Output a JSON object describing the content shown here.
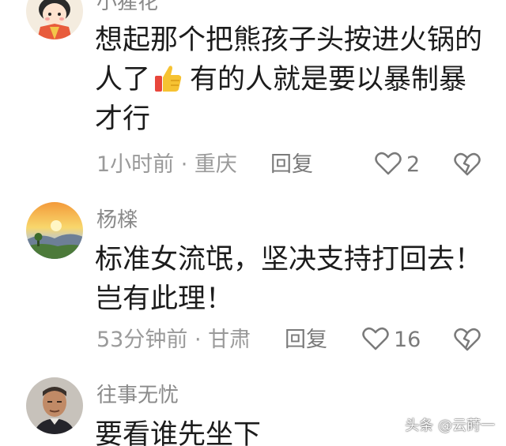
{
  "comments": [
    {
      "username": "小猩花",
      "lines": [
        "想起那个把熊孩子头按进火锅的",
        "人了",
        "有的人就是要以暴制暴",
        "才行"
      ],
      "emoji": "thumbs-up",
      "time_location": "1小时前 · 重庆",
      "reply_label": "回复",
      "like_count": "2"
    },
    {
      "username": "杨檪",
      "lines": [
        "标准女流氓，坚决支持打回去！",
        "岂有此理！"
      ],
      "time_location": "53分钟前 · 甘肃",
      "reply_label": "回复",
      "like_count": "16"
    },
    {
      "username": "往事无忧",
      "lines": [
        "要看谁先坐下"
      ]
    }
  ],
  "watermark": "头条 @云莳一",
  "colors": {
    "background": "#ffffff",
    "text": "#1c1c1c",
    "meta": "#9a9a9a",
    "icon": "#7a7a7a"
  }
}
